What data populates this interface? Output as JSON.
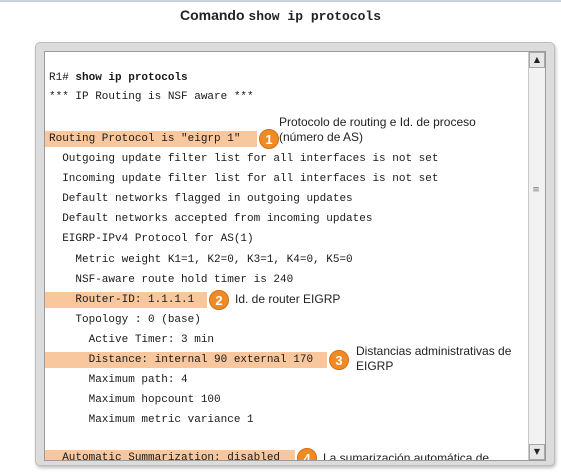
{
  "header": {
    "title_main": "Comando",
    "title_code": "show ip protocols"
  },
  "console": {
    "prompt": "R1#",
    "command": "show ip protocols",
    "lines": [
      "*** IP Routing is NSF aware ***",
      "Routing Protocol is \"eigrp 1\"",
      "  Outgoing update filter list for all interfaces is not set",
      "  Incoming update filter list for all interfaces is not set",
      "  Default networks flagged in outgoing updates",
      "  Default networks accepted from incoming updates",
      "  EIGRP-IPv4 Protocol for AS(1)",
      "    Metric weight K1=1, K2=0, K3=1, K4=0, K5=0",
      "    NSF-aware route hold timer is 240",
      "    Router-ID: 1.1.1.1",
      "    Topology : 0 (base)",
      "      Active Timer: 3 min",
      "      Distance: internal 90 external 170",
      "      Maximum path: 4",
      "      Maximum hopcount 100",
      "      Maximum metric variance 1",
      "  Automatic Summarization: disabled"
    ]
  },
  "annotations": [
    {
      "number": "1",
      "text_line1": "Protocolo de routing e Id. de proceso",
      "text_line2": "(número de AS)"
    },
    {
      "number": "2",
      "text_line1": "Id. de router EIGRP"
    },
    {
      "number": "3",
      "text_line1": "Distancias administrativas de",
      "text_line2": "EIGRP"
    },
    {
      "number": "4",
      "text_line1": "La sumarización automática de"
    }
  ],
  "scrollbar": {
    "up_icon": "triangle-up-icon",
    "down_icon": "triangle-down-icon",
    "grip_icon": "grip-icon"
  },
  "colors": {
    "highlight": "#f9c79d",
    "badge": "#f08a24"
  }
}
